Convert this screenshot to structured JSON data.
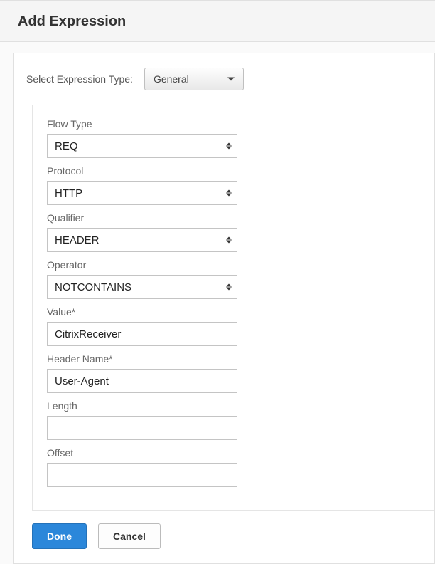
{
  "header": {
    "title": "Add Expression"
  },
  "typeSelector": {
    "label": "Select Expression Type:",
    "value": "General"
  },
  "fields": {
    "flowType": {
      "label": "Flow Type",
      "value": "REQ"
    },
    "protocol": {
      "label": "Protocol",
      "value": "HTTP"
    },
    "qualifier": {
      "label": "Qualifier",
      "value": "HEADER"
    },
    "operator": {
      "label": "Operator",
      "value": "NOTCONTAINS"
    },
    "value": {
      "label": "Value*",
      "value": "CitrixReceiver"
    },
    "headerName": {
      "label": "Header Name*",
      "value": "User-Agent"
    },
    "length": {
      "label": "Length",
      "value": ""
    },
    "offset": {
      "label": "Offset",
      "value": ""
    }
  },
  "buttons": {
    "done": "Done",
    "cancel": "Cancel"
  }
}
